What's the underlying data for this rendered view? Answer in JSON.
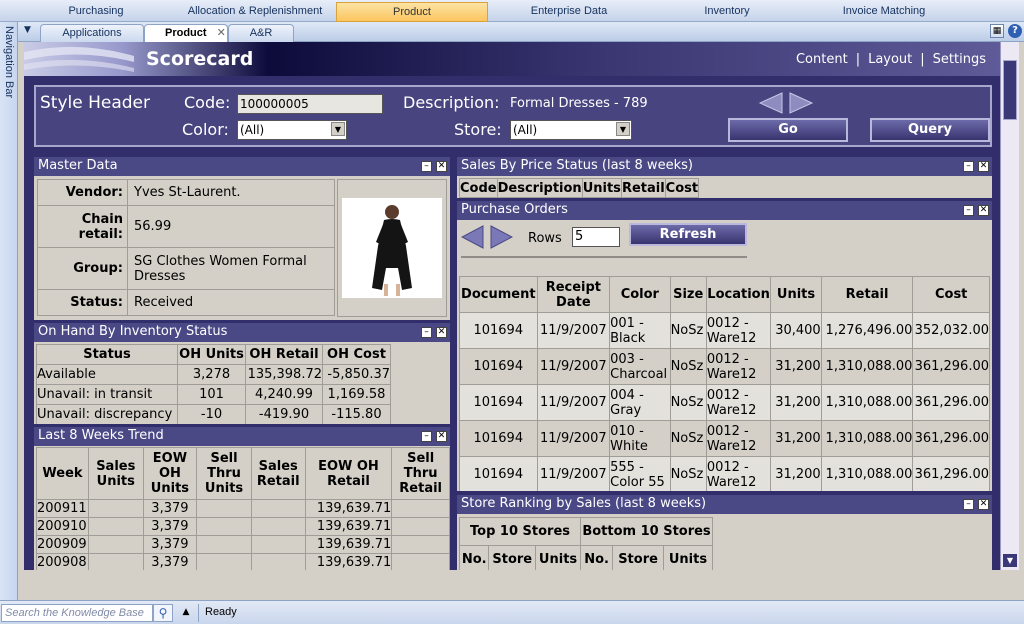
{
  "module_tabs": [
    "Purchasing",
    "Allocation & Replenishment",
    "Product",
    "Enterprise Data",
    "Inventory",
    "Invoice Matching"
  ],
  "doc_tabs": {
    "applications": "Applications",
    "product": "Product",
    "ar": "A&R"
  },
  "nav_bar_label": "Navigation Bar",
  "banner": {
    "title": "Scorecard",
    "links": [
      "Content",
      "Layout",
      "Settings"
    ],
    "sep": "|"
  },
  "style_header": {
    "title": "Style Header",
    "code_label": "Code:",
    "code_value": "100000005",
    "desc_label": "Description:",
    "desc_value": "Formal Dresses - 789",
    "color_label": "Color:",
    "color_value": "(All)",
    "store_label": "Store:",
    "store_value": "(All)",
    "go": "Go",
    "query": "Query"
  },
  "master": {
    "title": "Master Data",
    "rows": [
      {
        "k": "Vendor:",
        "v": "Yves St-Laurent."
      },
      {
        "k": "Chain retail:",
        "v": "56.99"
      },
      {
        "k": "Group:",
        "v": "SG Clothes Women Formal Dresses"
      },
      {
        "k": "Status:",
        "v": "Received"
      }
    ]
  },
  "onhand": {
    "title": "On Hand By Inventory Status",
    "headers": [
      "Status",
      "OH Units",
      "OH Retail",
      "OH Cost"
    ],
    "rows": [
      [
        "Available",
        "3,278",
        "135,398.72",
        "-5,850.37"
      ],
      [
        "Unavail: in transit",
        "101",
        "4,240.99",
        "1,169.58"
      ],
      [
        "Unavail: discrepancy",
        "-10",
        "-419.90",
        "-115.80"
      ]
    ]
  },
  "trend": {
    "title": "Last 8 Weeks Trend",
    "headers": [
      "Week",
      "Sales Units",
      "EOW OH Units",
      "Sell Thru Units",
      "Sales Retail",
      "EOW OH Retail",
      "Sell Thru Retail"
    ],
    "rows": [
      [
        "200911",
        "",
        "3,379",
        "",
        "",
        "139,639.71",
        ""
      ],
      [
        "200910",
        "",
        "3,379",
        "",
        "",
        "139,639.71",
        ""
      ],
      [
        "200909",
        "",
        "3,379",
        "",
        "",
        "139,639.71",
        ""
      ],
      [
        "200908",
        "",
        "3,379",
        "",
        "",
        "139,639.71",
        ""
      ]
    ]
  },
  "price_status": {
    "title": "Sales By Price Status (last 8 weeks)",
    "headers": [
      "Code",
      "Description",
      "Units",
      "Retail",
      "Cost"
    ]
  },
  "po": {
    "title": "Purchase Orders",
    "rows_label": "Rows",
    "rows_value": "5",
    "refresh": "Refresh",
    "headers": [
      "Document",
      "Receipt Date",
      "Color",
      "Size",
      "Location",
      "Units",
      "Retail",
      "Cost"
    ],
    "rows": [
      [
        "101694",
        "11/9/2007",
        "001 - Black",
        "NoSz",
        "0012 - Ware12",
        "30,400",
        "1,276,496.00",
        "352,032.00"
      ],
      [
        "101694",
        "11/9/2007",
        "003 - Charcoal",
        "NoSz",
        "0012 - Ware12",
        "31,200",
        "1,310,088.00",
        "361,296.00"
      ],
      [
        "101694",
        "11/9/2007",
        "004 - Gray",
        "NoSz",
        "0012 - Ware12",
        "31,200",
        "1,310,088.00",
        "361,296.00"
      ],
      [
        "101694",
        "11/9/2007",
        "010 - White",
        "NoSz",
        "0012 - Ware12",
        "31,200",
        "1,310,088.00",
        "361,296.00"
      ],
      [
        "101694",
        "11/9/2007",
        "555 - Color 55",
        "NoSz",
        "0012 - Ware12",
        "31,200",
        "1,310,088.00",
        "361,296.00"
      ]
    ]
  },
  "ranking": {
    "title": "Store Ranking by Sales (last 8 weeks)",
    "top": "Top 10 Stores",
    "bottom": "Bottom 10 Stores",
    "cols": [
      "No.",
      "Store",
      "Units"
    ]
  },
  "status_bar": {
    "search_placeholder": "Search the Knowledge Base",
    "status": "Ready"
  }
}
